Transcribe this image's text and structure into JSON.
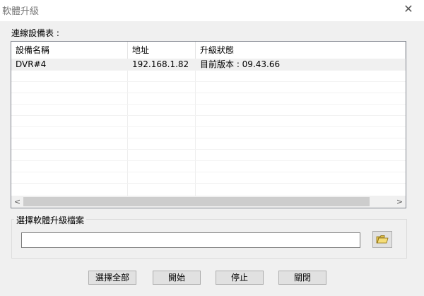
{
  "window": {
    "title": "軟體升級"
  },
  "device_list": {
    "label": "連線設備表 :",
    "columns": [
      "設備名稱",
      "地址",
      "升級狀態"
    ],
    "rows": [
      {
        "name": "DVR#4",
        "address": "192.168.1.82",
        "status": "目前版本 : 09.43.66"
      }
    ]
  },
  "file_group": {
    "label": "選擇軟體升級檔案",
    "path": ""
  },
  "buttons": {
    "select_all": "選擇全部",
    "start": "開始",
    "stop": "停止",
    "close": "關閉"
  },
  "icons": {
    "close": "close-icon",
    "browse": "folder-open-icon",
    "scroll_left": "chevron-left-icon",
    "scroll_right": "chevron-right-icon"
  }
}
